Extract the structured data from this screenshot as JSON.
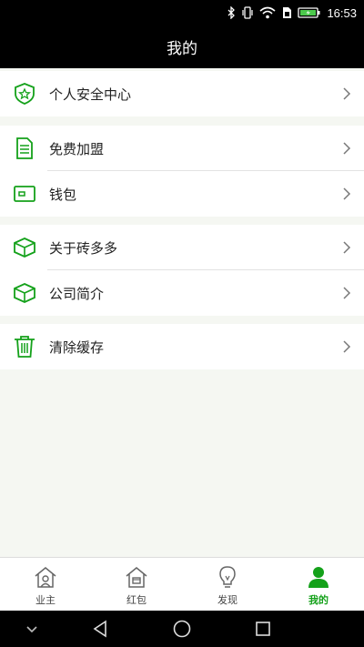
{
  "status_bar": {
    "time": "16:53",
    "icons": [
      "bluetooth-icon",
      "vibrate-icon",
      "wifi-icon",
      "sim-icon",
      "battery-icon"
    ]
  },
  "header": {
    "title": "我的"
  },
  "menu": {
    "groups": [
      {
        "items": [
          {
            "icon": "shield-star-icon",
            "label": "个人安全中心"
          }
        ]
      },
      {
        "items": [
          {
            "icon": "document-icon",
            "label": "免费加盟"
          },
          {
            "icon": "wallet-icon",
            "label": "钱包"
          }
        ]
      },
      {
        "items": [
          {
            "icon": "box-icon",
            "label": "关于砖多多"
          },
          {
            "icon": "box-icon",
            "label": "公司简介"
          }
        ]
      },
      {
        "items": [
          {
            "icon": "trash-icon",
            "label": "清除缓存"
          }
        ]
      }
    ]
  },
  "tabs": [
    {
      "icon": "owner-house-icon",
      "label": "业主",
      "active": false
    },
    {
      "icon": "redpacket-house-icon",
      "label": "红包",
      "active": false
    },
    {
      "icon": "lightbulb-icon",
      "label": "发现",
      "active": false
    },
    {
      "icon": "person-icon",
      "label": "我的",
      "active": true
    }
  ],
  "colors": {
    "accent": "#14a11a",
    "title_bar": "#000000",
    "background": "#f5f7f2"
  }
}
